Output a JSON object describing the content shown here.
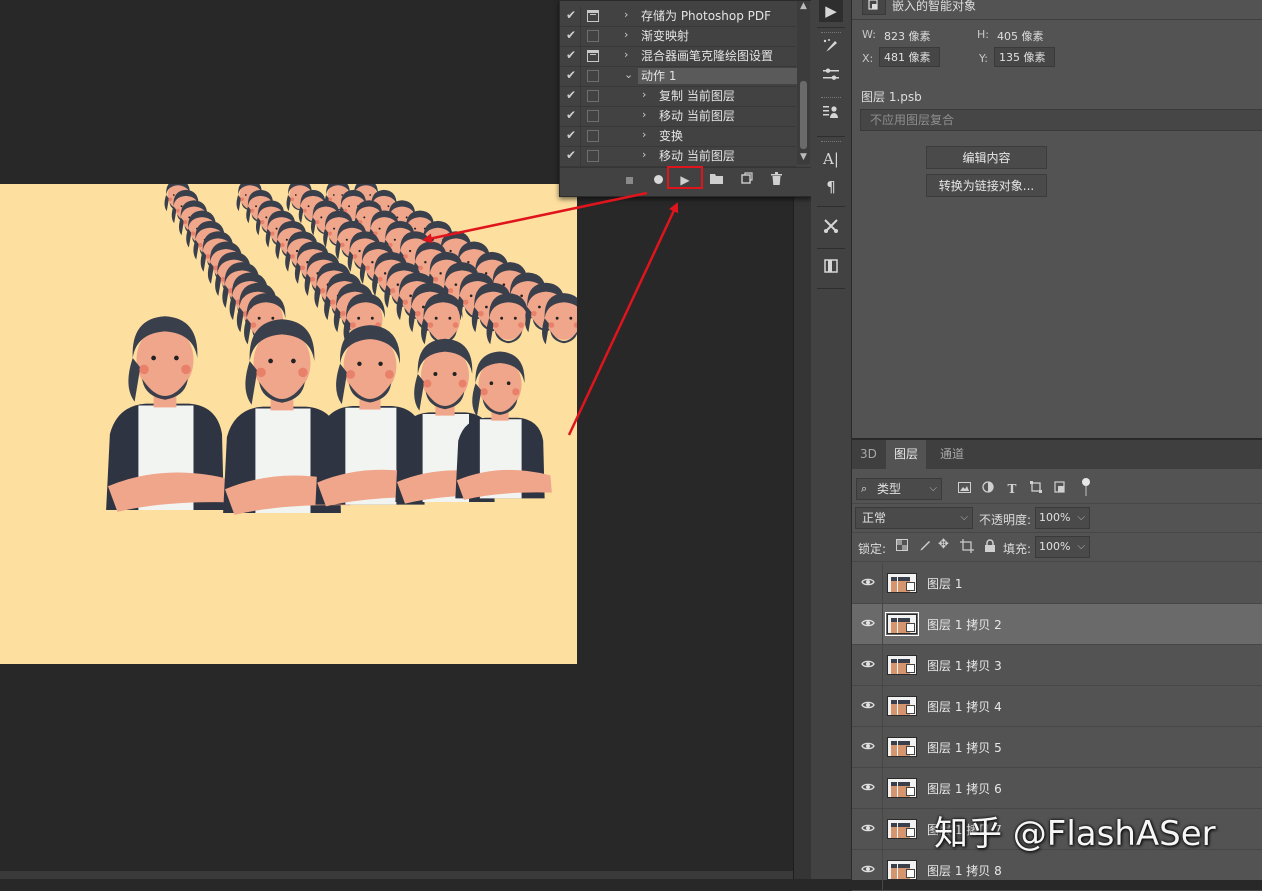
{
  "actions_panel": {
    "items": [
      {
        "checked": true,
        "dialog": true,
        "twirl": "›",
        "label": "存储为 Photoshop PDF",
        "indent": 0,
        "selected": false
      },
      {
        "checked": true,
        "dialog": false,
        "twirl": "›",
        "label": "渐变映射",
        "indent": 0,
        "selected": false
      },
      {
        "checked": true,
        "dialog": true,
        "twirl": "›",
        "label": "混合器画笔克隆绘图设置",
        "indent": 0,
        "selected": false
      },
      {
        "checked": true,
        "dialog": false,
        "twirl": "⌄",
        "label": "动作 1",
        "indent": 0,
        "selected": true
      },
      {
        "checked": true,
        "dialog": false,
        "twirl": "›",
        "label": "复制 当前图层",
        "indent": 1,
        "selected": false
      },
      {
        "checked": true,
        "dialog": false,
        "twirl": "›",
        "label": "移动 当前图层",
        "indent": 1,
        "selected": false
      },
      {
        "checked": true,
        "dialog": false,
        "twirl": "›",
        "label": "变换",
        "indent": 1,
        "selected": false
      },
      {
        "checked": true,
        "dialog": false,
        "twirl": "›",
        "label": "移动 当前图层",
        "indent": 1,
        "selected": false
      }
    ],
    "toolbar": [
      "stop",
      "record",
      "play",
      "new-set",
      "new-action",
      "delete"
    ]
  },
  "properties": {
    "header": "嵌入的智能对象",
    "w_label": "W:",
    "w_value": "823 像素",
    "h_label": "H:",
    "h_value": "405 像素",
    "x_label": "X:",
    "x_value": "481 像素",
    "y_label": "Y:",
    "y_value": "135 像素",
    "source_file": "图层 1.psb",
    "layer_comp_placeholder": "不应用图层复合",
    "edit_contents": "编辑内容",
    "convert_linked": "转换为链接对象..."
  },
  "layers_panel": {
    "tabs": [
      {
        "label": "3D",
        "active": false
      },
      {
        "label": "图层",
        "active": true
      },
      {
        "label": "通道",
        "active": false
      }
    ],
    "filter_kind": "类型",
    "blend_mode": "正常",
    "opacity_label": "不透明度:",
    "opacity_value": "100%",
    "lock_label": "锁定:",
    "fill_label": "填充:",
    "fill_value": "100%",
    "layers": [
      {
        "name": "图层 1",
        "selected": false
      },
      {
        "name": "图层 1 拷贝 2",
        "selected": true
      },
      {
        "name": "图层 1 拷贝 3",
        "selected": false
      },
      {
        "name": "图层 1 拷贝 4",
        "selected": false
      },
      {
        "name": "图层 1 拷贝 5",
        "selected": false
      },
      {
        "name": "图层 1 拷贝 6",
        "selected": false
      },
      {
        "name": "图层 1 拷贝 7",
        "selected": false
      },
      {
        "name": "图层 1 拷贝 8",
        "selected": false
      }
    ]
  },
  "watermark": "知乎 @FlashASer",
  "colors": {
    "canvas_bg": "#fde0a0",
    "annotation_red": "#e0141c",
    "hair": "#3a3f4c",
    "skin": "#f0a68a",
    "shirt": "#f2f4f2"
  }
}
